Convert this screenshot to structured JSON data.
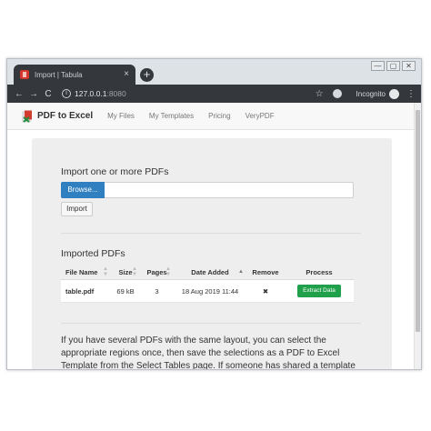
{
  "browser": {
    "tab_title": "Import | Tabula",
    "tab_close": "×",
    "new_tab": "+",
    "url_host": "127.0.0.1",
    "url_port": ":8080",
    "incognito_label": "Incognito",
    "back": "←",
    "forward": "→",
    "reload": "C",
    "info": "i",
    "star": "☆",
    "menu": "⋮",
    "win_min": "—",
    "win_max": "▢",
    "win_close": "✕"
  },
  "app": {
    "brand": "PDF to Excel",
    "nav": [
      "My Files",
      "My Templates",
      "Pricing",
      "VeryPDF"
    ]
  },
  "upload": {
    "heading": "Import one or more PDFs",
    "browse_label": "Browse...",
    "import_label": "Import"
  },
  "imported": {
    "heading": "Imported PDFs",
    "columns": [
      "File Name",
      "Size",
      "Pages",
      "Date Added",
      "Remove",
      "Process"
    ],
    "rows": [
      {
        "file_name": "table.pdf",
        "size": "69 kB",
        "pages": "3",
        "date_added": "18 Aug 2019 11:44",
        "remove": "✖",
        "process": "Extract Data"
      }
    ]
  },
  "info_text": "If you have several PDFs with the same layout, you can select the appropriate regions once, then save the selections as a PDF to Excel Template from the Select Tables page. If someone has shared a template"
}
